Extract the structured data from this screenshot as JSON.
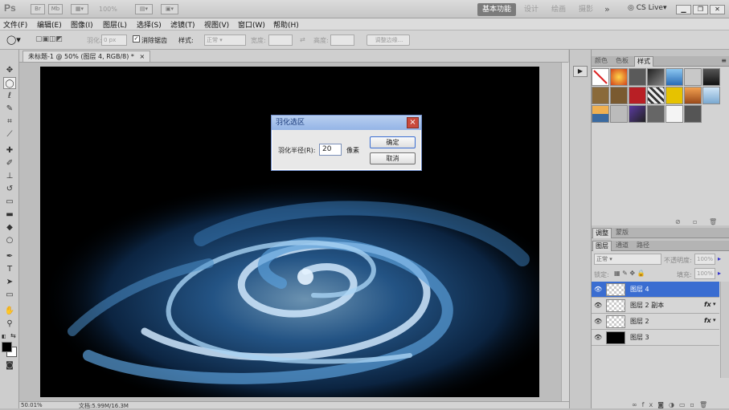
{
  "app": {
    "logo": "Ps",
    "br_icon": "Br",
    "mb_icon": "Mb",
    "zoom": "100%",
    "workspaces": [
      "基本功能",
      "设计",
      "绘画",
      "摄影"
    ],
    "more": "»",
    "cs_live": "CS Live▾"
  },
  "menu": [
    "文件(F)",
    "编辑(E)",
    "图像(I)",
    "图层(L)",
    "选择(S)",
    "滤镜(T)",
    "视图(V)",
    "窗口(W)",
    "帮助(H)"
  ],
  "options": {
    "feather_label": "羽化:",
    "feather_value": "0 px",
    "antialias_label": "消除锯齿",
    "style_label": "样式:",
    "style_value": "正常",
    "width_label": "宽度:",
    "height_label": "高度:",
    "refine_button": "调整边缘..."
  },
  "document": {
    "tab_title": "未标题-1 @ 50% (图层 4, RGB/8) *",
    "close": "×"
  },
  "status": {
    "zoom": "50.01%",
    "doc_info": "文档:5.99M/16.3M"
  },
  "dialog": {
    "title": "羽化选区",
    "radius_label": "羽化半径(R):",
    "radius_value": "20",
    "unit": "像素",
    "ok": "确定",
    "cancel": "取消",
    "close": "×"
  },
  "panels": {
    "top_tabs": [
      "颜色",
      "色板",
      "样式"
    ],
    "mid_tabs": [
      "调整",
      "蒙版"
    ],
    "layer_tabs": [
      "图层",
      "通道",
      "路径"
    ],
    "blend_mode": "正常",
    "opacity_label": "不透明度:",
    "opacity_value": "100%",
    "lock_label": "锁定:",
    "fill_label": "填充:",
    "fill_value": "100%",
    "layers": [
      {
        "name": "图层 4",
        "selected": true,
        "fx": "",
        "thumb": "transparent"
      },
      {
        "name": "图层 2 副本",
        "selected": false,
        "fx": "fx",
        "thumb": "transparent"
      },
      {
        "name": "图层 2",
        "selected": false,
        "fx": "fx",
        "thumb": "transparent"
      },
      {
        "name": "图层 3",
        "selected": false,
        "fx": "",
        "thumb": "black"
      }
    ]
  },
  "colors": {
    "accent": "#3a6dd1",
    "galaxy": "#2f6fb0",
    "dialog_title": "#94b4e6"
  }
}
